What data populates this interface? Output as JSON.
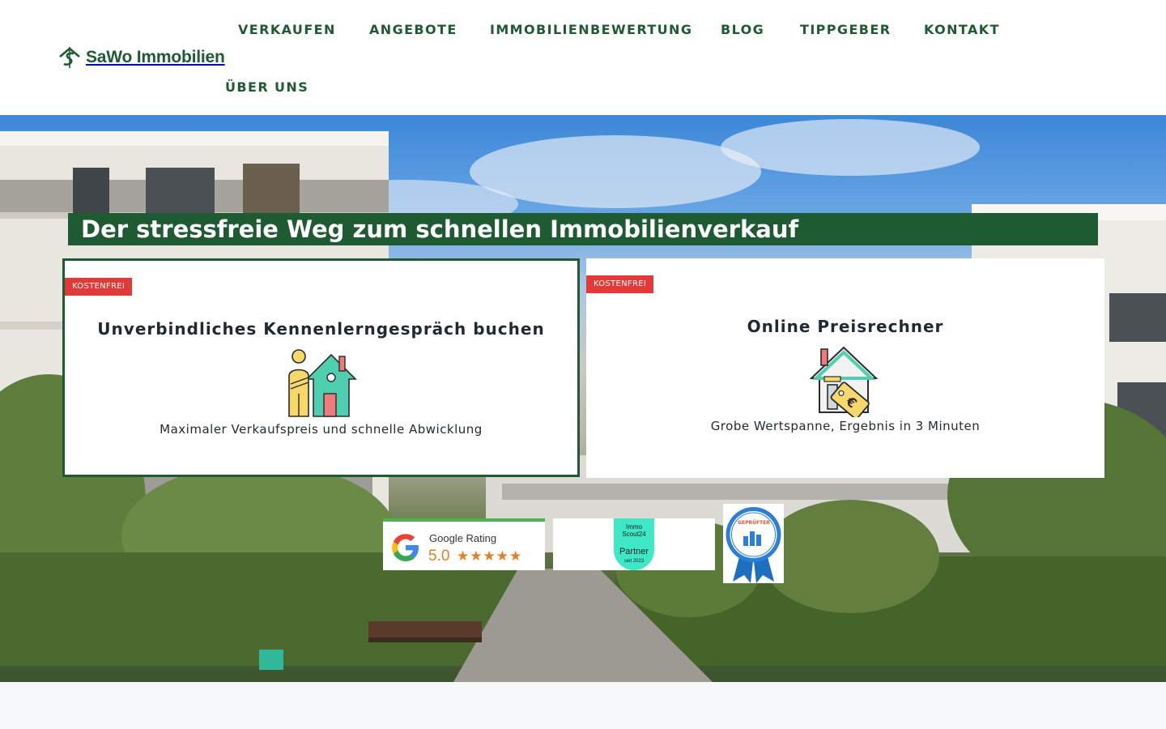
{
  "brand": {
    "name": "SaWo Immobilien",
    "logo_icon": "house-s-logo-icon",
    "color": "#1e5b33"
  },
  "nav": {
    "items": [
      {
        "label": "VERKAUFEN"
      },
      {
        "label": "ANGEBOTE"
      },
      {
        "label": "IMMOBILIENBEWERTUNG"
      },
      {
        "label": "BLOG"
      },
      {
        "label": "TIPPGEBER"
      },
      {
        "label": "KONTAKT"
      },
      {
        "label": "ÜBER UNS"
      }
    ]
  },
  "hero": {
    "headline": "Der stressfreie Weg zum schnellen Immobilienverkauf",
    "headline_bg": "#1e5b33",
    "cards": [
      {
        "badge": "KOSTENFREI",
        "title": "Unverbindliches Kennenlerngespräch buchen",
        "icon": "person-house-icon",
        "description": "Maximaler Verkaufspreis und schnelle Abwicklung"
      },
      {
        "badge": "KOSTENFREI",
        "title": "Online Preisrechner",
        "icon": "house-price-tag-euro-icon",
        "description": "Grobe Wertspanne, Ergebnis in 3 Minuten"
      }
    ],
    "badge_color": "#e33a38"
  },
  "trust": {
    "google": {
      "label": "Google Rating",
      "score": "5.0",
      "stars": "★★★★★",
      "icon": "google-g-icon"
    },
    "immoscout": {
      "top": "Immo Scout24",
      "partner": "Partner",
      "since": "seit 2023",
      "icon": "immoscout-partner-icon"
    },
    "seal": {
      "label": "GEPRÜFTER",
      "icon": "award-rosette-icon"
    }
  }
}
